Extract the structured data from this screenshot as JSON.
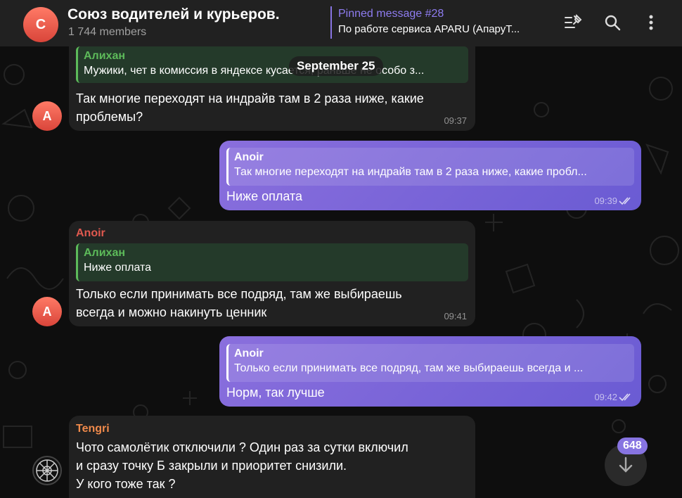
{
  "header": {
    "avatar_letter": "С",
    "title": "Союз водителей и курьеров.",
    "subtitle": "1 744 members",
    "pinned_title": "Pinned message #28",
    "pinned_text": "По работе сервиса APARU (АпаруТ..."
  },
  "date_label": "September 25",
  "messages": [
    {
      "reply_name": "Алихан",
      "reply_text": "Мужики, чет в комиссия в яндексе кусается, раньше не особо з...",
      "text": "Так многие переходят на индрайв там в 2 раза ниже, какие\nпроблемы?",
      "time": "09:37",
      "avatar": "A"
    },
    {
      "reply_name": "Anoir",
      "reply_text": "Так многие переходят на индрайв там в 2 раза ниже, какие пробл...",
      "text": "Ниже оплата",
      "time": "09:39"
    },
    {
      "sender": "Anoir",
      "sender_color": "#e0594f",
      "reply_name": "Алихан",
      "reply_text": "Ниже оплата",
      "text": "Только если принимать все подряд, там же выбираешь\nвсегда и можно накинуть ценник",
      "time": "09:41",
      "avatar": "A"
    },
    {
      "reply_name": "Anoir",
      "reply_text": "Только если принимать все подряд, там же выбираешь всегда и ...",
      "text": "Норм, так лучше",
      "time": "09:42"
    },
    {
      "sender": "Tengri",
      "sender_color": "#f08a4b",
      "text": "Чото самолётик отключили ? Один раз за сутки  включил\nи сразу точку Б закрыли и приоритет снизили.\nУ кого тоже так ?"
    }
  ],
  "unread_count": "648",
  "colors": {
    "accent": "#8774e1",
    "incoming": "#212121",
    "outgoing": "#7b66d9"
  },
  "icons": [
    "pinned-list-icon",
    "search-icon",
    "more-vertical-icon",
    "read-checks-icon",
    "arrow-down-icon"
  ]
}
